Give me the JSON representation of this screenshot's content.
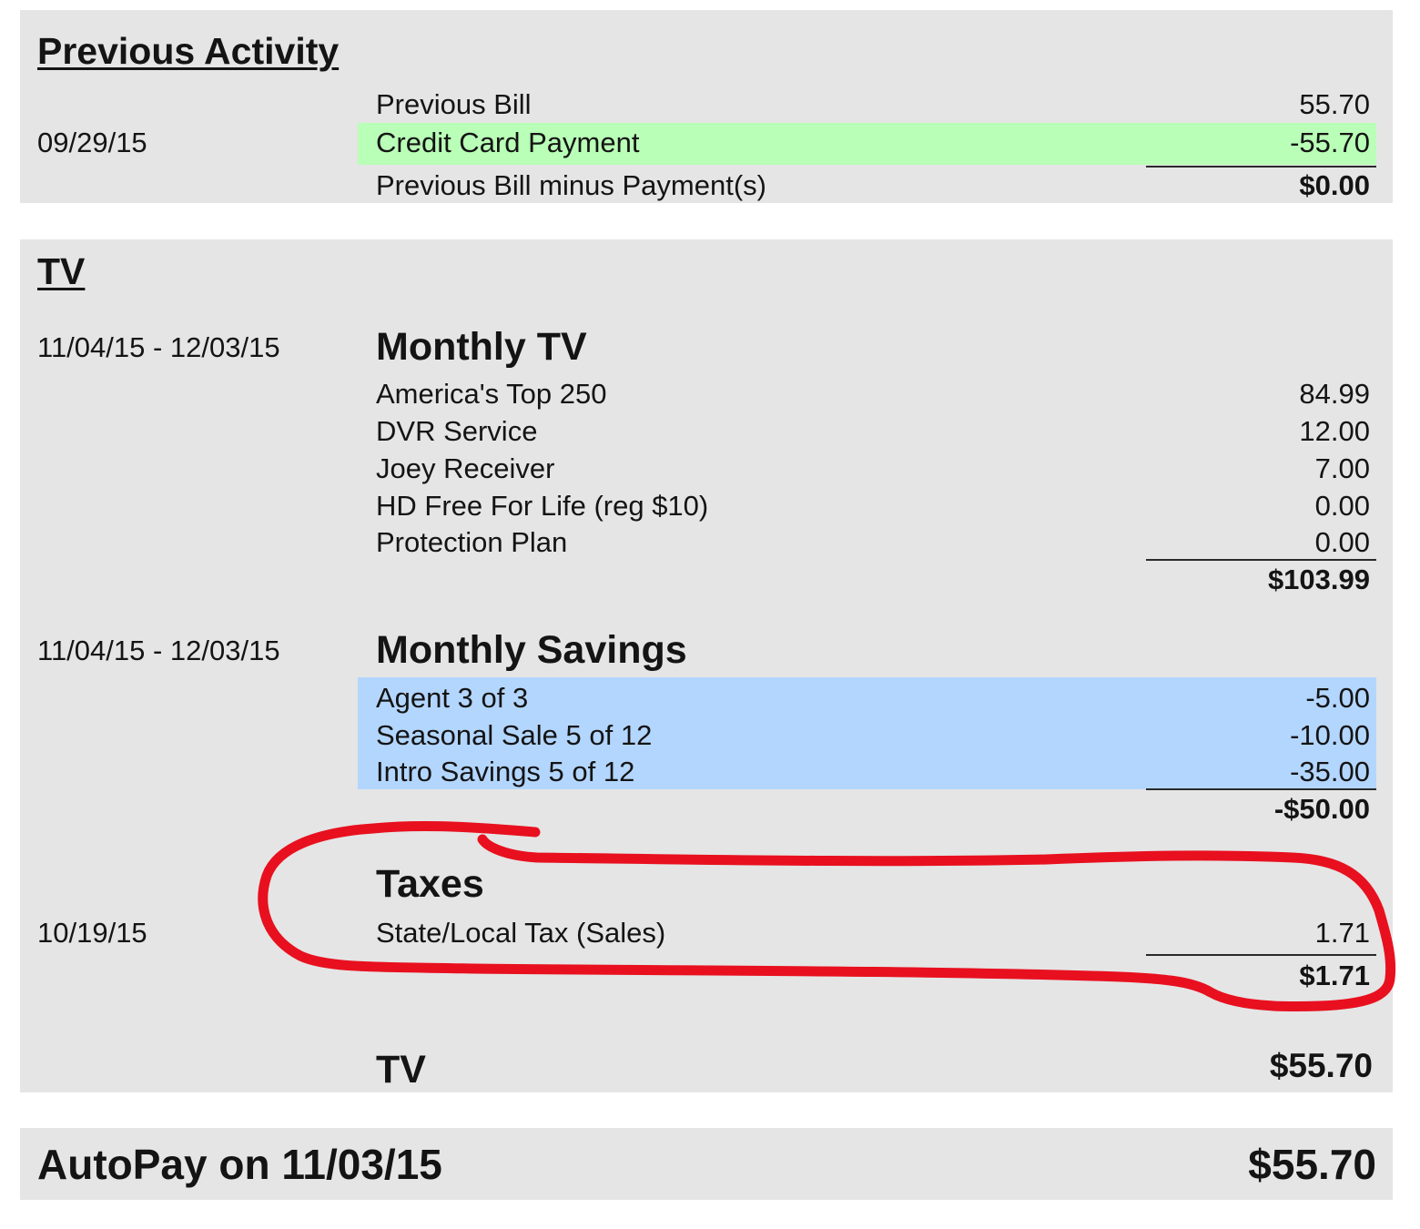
{
  "previous_activity": {
    "heading": "Previous Activity",
    "date": "09/29/15",
    "rows": [
      {
        "label": "Previous Bill",
        "amount": "55.70"
      },
      {
        "label": "Credit Card Payment",
        "amount": "-55.70"
      }
    ],
    "total_label": "Previous Bill minus Payment(s)",
    "total_amount": "$0.00",
    "highlight_color": "#b9ffb7"
  },
  "tv": {
    "heading": "TV",
    "monthly_tv": {
      "date": "11/04/15 - 12/03/15",
      "title": "Monthly TV",
      "rows": [
        {
          "label": "America's Top 250",
          "amount": "84.99"
        },
        {
          "label": "DVR Service",
          "amount": "12.00"
        },
        {
          "label": "Joey Receiver",
          "amount": "7.00"
        },
        {
          "label": "HD Free For Life (reg $10)",
          "amount": "0.00"
        },
        {
          "label": "Protection Plan",
          "amount": "0.00"
        }
      ],
      "subtotal": "$103.99"
    },
    "monthly_savings": {
      "date": "11/04/15 - 12/03/15",
      "title": "Monthly Savings",
      "rows": [
        {
          "label": "Agent 3 of 3",
          "amount": "-5.00"
        },
        {
          "label": "Seasonal Sale 5 of 12",
          "amount": "-10.00"
        },
        {
          "label": "Intro Savings 5 of 12",
          "amount": "-35.00"
        }
      ],
      "subtotal": "-$50.00",
      "highlight_color": "#b3d6ff"
    },
    "taxes": {
      "title": "Taxes",
      "date": "10/19/15",
      "rows": [
        {
          "label": "State/Local Tax (Sales)",
          "amount": "1.71"
        }
      ],
      "subtotal": "$1.71"
    },
    "total_label": "TV",
    "total_amount": "$55.70"
  },
  "autopay": {
    "label": "AutoPay on 11/03/15",
    "amount": "$55.70"
  },
  "annotation_color": "#e8101f"
}
